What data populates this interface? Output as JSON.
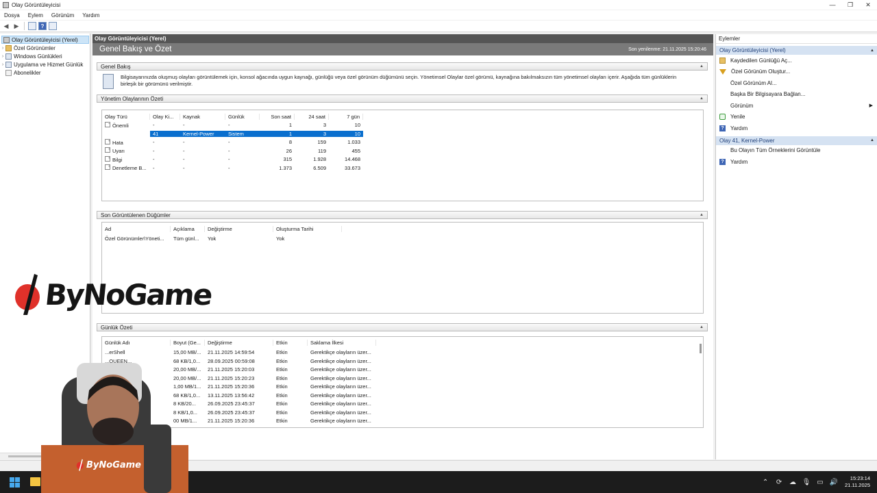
{
  "window": {
    "title": "Olay Görüntüleyicisi"
  },
  "menu": [
    "Dosya",
    "Eylem",
    "Görünüm",
    "Yardım"
  ],
  "tree": {
    "root": "Olay Görüntüleyicisi (Yerel)",
    "items": [
      "Özel Görünümler",
      "Windows Günlükleri",
      "Uygulama ve Hizmet Günlük",
      "Abonelikler"
    ]
  },
  "center": {
    "header": "Olay Görüntüleyicisi (Yerel)",
    "title": "Genel Bakış ve Özet",
    "refreshed": "Son yenilenme: 21.11.2025 15:20:46",
    "overview": {
      "title": "Genel Bakış",
      "text": "Bilgisayarınızda oluşmuş olayları görüntülemek için, konsol ağacında uygun kaynağı, günlüğü veya özel görünüm düğümünü seçin. Yönetimsel Olaylar özel görümü, kaynağına bakılmaksızın tüm yönetimsel olayları içerir. Aşağıda tüm günlüklerin birleşik bir görümünü verilmiştir."
    },
    "summary": {
      "title": "Yönetim Olaylarının Özeti",
      "columns": [
        "Olay Türü",
        "Olay Ki...",
        "Kaynak",
        "Günlük",
        "Son saat",
        "24 saat",
        "7 gün"
      ],
      "rows": [
        {
          "sign": "−",
          "type": "Önemli",
          "id": "-",
          "source": "-",
          "log": "-",
          "hour": "1",
          "day": "3",
          "week": "10"
        },
        {
          "sign": "",
          "type": "",
          "id": "41",
          "source": "Kernel-Power",
          "log": "Sistem",
          "hour": "1",
          "day": "3",
          "week": "10",
          "selected": true
        },
        {
          "sign": "+",
          "type": "Hata",
          "id": "-",
          "source": "-",
          "log": "-",
          "hour": "8",
          "day": "159",
          "week": "1.033"
        },
        {
          "sign": "+",
          "type": "Uyarı",
          "id": "-",
          "source": "-",
          "log": "-",
          "hour": "26",
          "day": "119",
          "week": "455"
        },
        {
          "sign": "+",
          "type": "Bilgi",
          "id": "-",
          "source": "-",
          "log": "-",
          "hour": "315",
          "day": "1.928",
          "week": "14.468"
        },
        {
          "sign": "+",
          "type": "Denetleme B...",
          "id": "-",
          "source": "-",
          "log": "-",
          "hour": "1.373",
          "day": "6.509",
          "week": "33.673"
        }
      ]
    },
    "recent": {
      "title": "Son Görüntülenen Düğümler",
      "columns": [
        "Ad",
        "Açıklama",
        "Değiştirme",
        "Oluşturma Tarihi"
      ],
      "rows": [
        {
          "name": "Özel Görünümler\\Yöneti...",
          "desc": "Tüm günl...",
          "modified": "Yok",
          "created": "Yok"
        }
      ]
    },
    "logsum": {
      "title": "Günlük Özeti",
      "columns": [
        "Günlük Adı",
        "Boyut (Ge...",
        "Değiştirme",
        "Etkin",
        "Saklama İlkesi"
      ],
      "rows": [
        {
          "name": "...erShell",
          "size": "15,00 MB/...",
          "mod": "21.11.2025 14:59:54",
          "on": "Etkin",
          "pol": "Gerektikçe olayların üzer..."
        },
        {
          "name": "...QUEEN...",
          "size": "68 KB/1,0...",
          "mod": "28.09.2025 00:59:08",
          "on": "Etkin",
          "pol": "Gerektikçe olayların üzer..."
        },
        {
          "name": "",
          "size": "20,00 MB/...",
          "mod": "21.11.2025 15:20:03",
          "on": "Etkin",
          "pol": "Gerektikçe olayların üzer..."
        },
        {
          "name": "",
          "size": "20,00 MB/...",
          "mod": "21.11.2025 15:20:23",
          "on": "Etkin",
          "pol": "Gerektikçe olayların üzer..."
        },
        {
          "name": "",
          "size": "1,00 MB/1...",
          "mod": "21.11.2025 15:20:36",
          "on": "Etkin",
          "pol": "Gerektikçe olayların üzer..."
        },
        {
          "name": "",
          "size": "68 KB/1,0...",
          "mod": "13.11.2025 13:56:42",
          "on": "Etkin",
          "pol": "Gerektikçe olayların üzer..."
        },
        {
          "name": "",
          "size": "8 KB/20...",
          "mod": "26.09.2025 23:45:37",
          "on": "Etkin",
          "pol": "Gerektikçe olayların üzer..."
        },
        {
          "name": "",
          "size": "8 KB/1,0...",
          "mod": "26.09.2025 23:45:37",
          "on": "Etkin",
          "pol": "Gerektikçe olayların üzer..."
        },
        {
          "name": "",
          "size": "00 MB/1...",
          "mod": "21.11.2025 15:20:36",
          "on": "Etkin",
          "pol": "Gerektikçe olayların üzer..."
        }
      ]
    }
  },
  "actions": {
    "title": "Eylemler",
    "group1": {
      "title": "Olay Görüntüleyicisi (Yerel)",
      "items": [
        {
          "label": "Kaydedilen Günlüğü Aç...",
          "icon": "open-log-icon"
        },
        {
          "label": "Özel Görünüm Oluştur...",
          "icon": "filter-icon"
        },
        {
          "label": "Özel Görünüm Al...",
          "icon": ""
        },
        {
          "label": "Başka Bir Bilgisayara Bağlan...",
          "icon": ""
        },
        {
          "label": "Görünüm",
          "icon": ""
        },
        {
          "label": "Yenile",
          "icon": "refresh-icon"
        },
        {
          "label": "Yardım",
          "icon": "help-icon"
        }
      ]
    },
    "group2": {
      "title": "Olay 41, Kernel-Power",
      "items": [
        {
          "label": "Bu Olayın Tüm Örneklerini Görüntüle",
          "icon": ""
        },
        {
          "label": "Yardım",
          "icon": "help-icon"
        }
      ]
    }
  },
  "overlay": {
    "brand": "ByNoGame",
    "cam_brand": "ByNoGame"
  },
  "taskbar": {
    "time": "15:23:14",
    "date": "21.11.2025"
  }
}
